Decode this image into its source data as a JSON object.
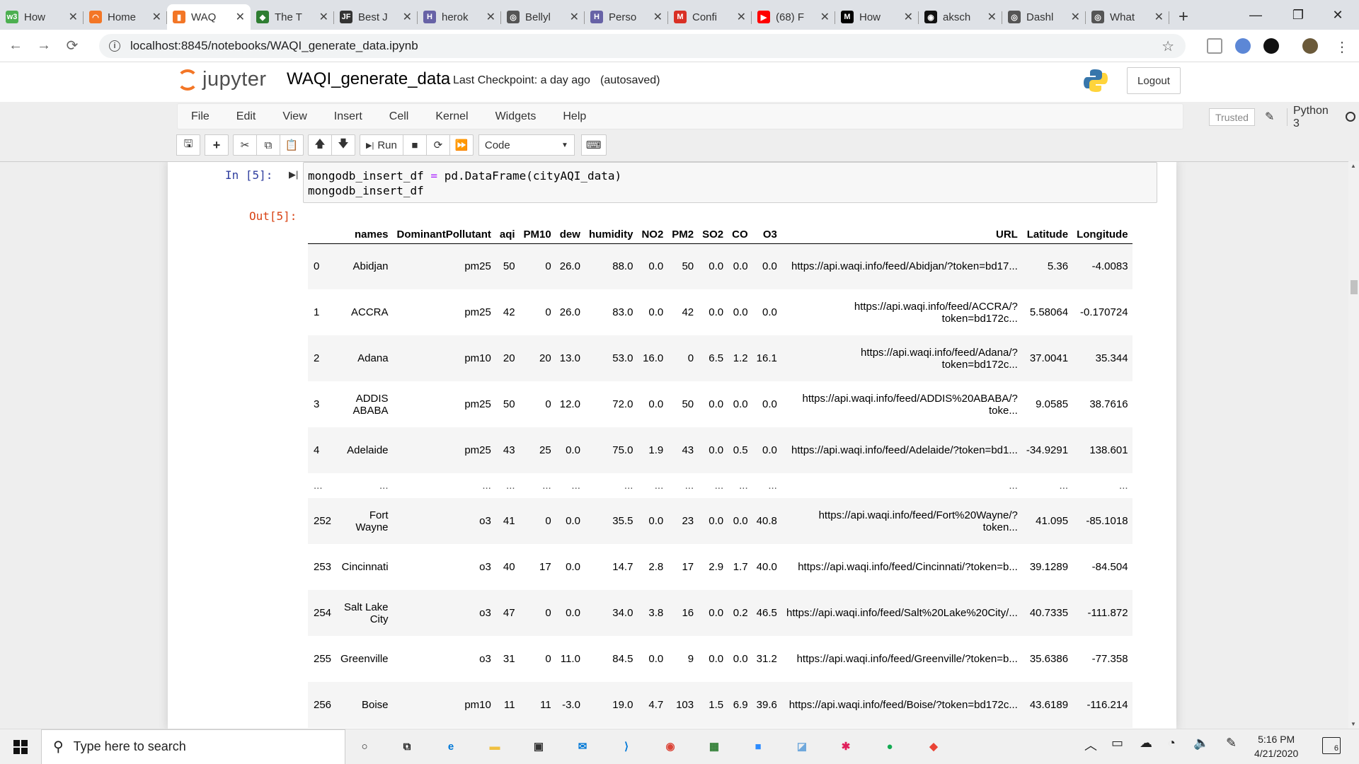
{
  "browser": {
    "tabs": [
      {
        "title": "How",
        "favicon_color": "#4caf50",
        "favicon_glyph": "w3"
      },
      {
        "title": "Home",
        "favicon_color": "#f37626",
        "favicon_glyph": "◠"
      },
      {
        "title": "WAQ",
        "favicon_color": "#f37626",
        "favicon_glyph": "▮"
      },
      {
        "title": "The T",
        "favicon_color": "#2e7d32",
        "favicon_glyph": "◆"
      },
      {
        "title": "Best J",
        "favicon_color": "#333333",
        "favicon_glyph": "JF"
      },
      {
        "title": "herok",
        "favicon_color": "#6762a6",
        "favicon_glyph": "H"
      },
      {
        "title": "Bellyl",
        "favicon_color": "#555555",
        "favicon_glyph": "◎"
      },
      {
        "title": "Perso",
        "favicon_color": "#6762a6",
        "favicon_glyph": "H"
      },
      {
        "title": "Confi",
        "favicon_color": "#d93025",
        "favicon_glyph": "M"
      },
      {
        "title": "(68) F",
        "favicon_color": "#ff0000",
        "favicon_glyph": "▶"
      },
      {
        "title": "How",
        "favicon_color": "#000000",
        "favicon_glyph": "M"
      },
      {
        "title": "aksch",
        "favicon_color": "#111111",
        "favicon_glyph": "◉"
      },
      {
        "title": "Dashl",
        "favicon_color": "#555555",
        "favicon_glyph": "◎"
      },
      {
        "title": "What",
        "favicon_color": "#555555",
        "favicon_glyph": "◎"
      }
    ],
    "active_tab_index": 2,
    "new_tab_label": "+",
    "url": "localhost:8845/notebooks/WAQI_generate_data.ipynb",
    "window_controls": {
      "minimize": "—",
      "maximize": "❐",
      "close": "✕"
    }
  },
  "jupyter": {
    "logo_text": "jupyter",
    "notebook_name": "WAQI_generate_data",
    "checkpoint": "Last Checkpoint: a day ago",
    "autosave": "(autosaved)",
    "logout_label": "Logout",
    "menu": [
      "File",
      "Edit",
      "View",
      "Insert",
      "Cell",
      "Kernel",
      "Widgets",
      "Help"
    ],
    "trusted_label": "Trusted",
    "kernel_name": "Python 3",
    "toolbar": {
      "run_label": "Run",
      "cell_type": "Code"
    }
  },
  "cell": {
    "in_prompt": "In [5]:",
    "out_prompt": "Out[5]:",
    "code_line1_var": "mongodb_insert_df",
    "code_line1_eq": "=",
    "code_line1_rest": "pd.DataFrame(cityAQI_data)",
    "code_line2": "mongodb_insert_df"
  },
  "dataframe": {
    "columns": [
      "",
      "names",
      "DominantPollutant",
      "aqi",
      "PM10",
      "dew",
      "humidity",
      "NO2",
      "PM2",
      "SO2",
      "CO",
      "O3",
      "URL",
      "Latitude",
      "Longitude"
    ],
    "rows": [
      [
        "0",
        "Abidjan",
        "pm25",
        "50",
        "0",
        "26.0",
        "88.0",
        "0.0",
        "50",
        "0.0",
        "0.0",
        "0.0",
        "https://api.waqi.info/feed/Abidjan/?token=bd17...",
        "5.36",
        "-4.0083"
      ],
      [
        "1",
        "ACCRA",
        "pm25",
        "42",
        "0",
        "26.0",
        "83.0",
        "0.0",
        "42",
        "0.0",
        "0.0",
        "0.0",
        "https://api.waqi.info/feed/ACCRA/?token=bd172c...",
        "5.58064",
        "-0.170724"
      ],
      [
        "2",
        "Adana",
        "pm10",
        "20",
        "20",
        "13.0",
        "53.0",
        "16.0",
        "0",
        "6.5",
        "1.2",
        "16.1",
        "https://api.waqi.info/feed/Adana/?token=bd172c...",
        "37.0041",
        "35.344"
      ],
      [
        "3",
        "ADDIS ABABA",
        "pm25",
        "50",
        "0",
        "12.0",
        "72.0",
        "0.0",
        "50",
        "0.0",
        "0.0",
        "0.0",
        "https://api.waqi.info/feed/ADDIS%20ABABA/?toke...",
        "9.0585",
        "38.7616"
      ],
      [
        "4",
        "Adelaide",
        "pm25",
        "43",
        "25",
        "0.0",
        "75.0",
        "1.9",
        "43",
        "0.0",
        "0.5",
        "0.0",
        "https://api.waqi.info/feed/Adelaide/?token=bd1...",
        "-34.9291",
        "138.601"
      ],
      [
        "...",
        "...",
        "...",
        "...",
        "...",
        "...",
        "...",
        "...",
        "...",
        "...",
        "...",
        "...",
        "...",
        "...",
        "..."
      ],
      [
        "252",
        "Fort Wayne",
        "o3",
        "41",
        "0",
        "0.0",
        "35.5",
        "0.0",
        "23",
        "0.0",
        "0.0",
        "40.8",
        "https://api.waqi.info/feed/Fort%20Wayne/?token...",
        "41.095",
        "-85.1018"
      ],
      [
        "253",
        "Cincinnati",
        "o3",
        "40",
        "17",
        "0.0",
        "14.7",
        "2.8",
        "17",
        "2.9",
        "1.7",
        "40.0",
        "https://api.waqi.info/feed/Cincinnati/?token=b...",
        "39.1289",
        "-84.504"
      ],
      [
        "254",
        "Salt Lake City",
        "o3",
        "47",
        "0",
        "0.0",
        "34.0",
        "3.8",
        "16",
        "0.0",
        "0.2",
        "46.5",
        "https://api.waqi.info/feed/Salt%20Lake%20City/...",
        "40.7335",
        "-111.872"
      ],
      [
        "255",
        "Greenville",
        "o3",
        "31",
        "0",
        "11.0",
        "84.5",
        "0.0",
        "9",
        "0.0",
        "0.0",
        "31.2",
        "https://api.waqi.info/feed/Greenville/?token=b...",
        "35.6386",
        "-77.358"
      ],
      [
        "256",
        "Boise",
        "pm10",
        "11",
        "11",
        "-3.0",
        "19.0",
        "4.7",
        "103",
        "1.5",
        "6.9",
        "39.6",
        "https://api.waqi.info/feed/Boise/?token=bd172c...",
        "43.6189",
        "-116.214"
      ]
    ]
  },
  "taskbar": {
    "search_placeholder": "Type here to search",
    "time": "5:16 PM",
    "date": "4/21/2020",
    "notification_count": "6",
    "apps": [
      {
        "name": "cortana",
        "glyph": "○",
        "color": "#222222"
      },
      {
        "name": "task-view",
        "glyph": "⧉",
        "color": "#222222"
      },
      {
        "name": "edge",
        "glyph": "e",
        "color": "#0078d7"
      },
      {
        "name": "file-explorer",
        "glyph": "▬",
        "color": "#f0c040"
      },
      {
        "name": "store",
        "glyph": "▣",
        "color": "#333333"
      },
      {
        "name": "mail",
        "glyph": "✉",
        "color": "#0078d7"
      },
      {
        "name": "vscode",
        "glyph": "⟩",
        "color": "#0078d7"
      },
      {
        "name": "chrome",
        "glyph": "◉",
        "color": "#db4437"
      },
      {
        "name": "excel-chart",
        "glyph": "▦",
        "color": "#2e7d32"
      },
      {
        "name": "zoom",
        "glyph": "■",
        "color": "#2d8cff"
      },
      {
        "name": "notes",
        "glyph": "◪",
        "color": "#6fa8dc"
      },
      {
        "name": "slack",
        "glyph": "✱",
        "color": "#e01e5a"
      },
      {
        "name": "mongodb",
        "glyph": "●",
        "color": "#13aa52"
      },
      {
        "name": "git-kraken",
        "glyph": "◆",
        "color": "#ea4335"
      }
    ]
  }
}
